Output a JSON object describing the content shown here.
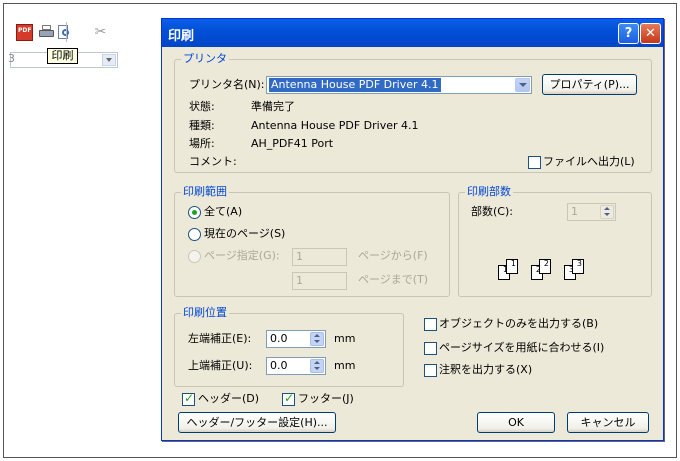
{
  "background_toolbar": {
    "tooltip": "印刷",
    "combo_fragment": "3"
  },
  "dialog": {
    "title": "印刷",
    "help_button": "?",
    "close_button": "✕",
    "printer": {
      "group_label": "プリンタ",
      "name_label": "プリンタ名(N):",
      "name_value": "Antenna House PDF Driver 4.1",
      "properties_button": "プロパティ(P)...",
      "status_label": "状態:",
      "status_value": "準備完了",
      "type_label": "種類:",
      "type_value": "Antenna House PDF Driver 4.1",
      "location_label": "場所:",
      "location_value": "AH_PDF41 Port",
      "comment_label": "コメント:",
      "print_to_file_label": "ファイルへ出力(L)",
      "print_to_file_checked": false
    },
    "range": {
      "group_label": "印刷範囲",
      "all_label": "全て(A)",
      "current_page_label": "現在のページ(S)",
      "pages_label": "ページ指定(G):",
      "from_value": "1",
      "from_label": "ページから(F)",
      "to_value": "1",
      "to_label": "ページまで(T)",
      "selected": "all"
    },
    "copies": {
      "group_label": "印刷部数",
      "count_label": "部数(C):",
      "count_value": "1",
      "collate_pages": [
        "1",
        "1",
        "2",
        "2",
        "3",
        "3"
      ]
    },
    "position": {
      "group_label": "印刷位置",
      "left_label": "左端補正(E):",
      "left_value": "0.0",
      "left_unit": "mm",
      "top_label": "上端補正(U):",
      "top_value": "0.0",
      "top_unit": "mm"
    },
    "options": {
      "objects_only_label": "オブジェクトのみを出力する(B)",
      "fit_page_label": "ページサイズを用紙に合わせる(I)",
      "annotations_label": "注釈を出力する(X)"
    },
    "header_label": "ヘッダー(D)",
    "footer_label": "フッター(J)",
    "header_footer_button": "ヘッダー/フッター設定(H)...",
    "ok_button": "OK",
    "cancel_button": "キャンセル"
  },
  "colors": {
    "titlebar": "#0350d8",
    "dialog_face": "#ece9d8",
    "group_label": "#0046d5",
    "check_mark": "#21a121"
  }
}
